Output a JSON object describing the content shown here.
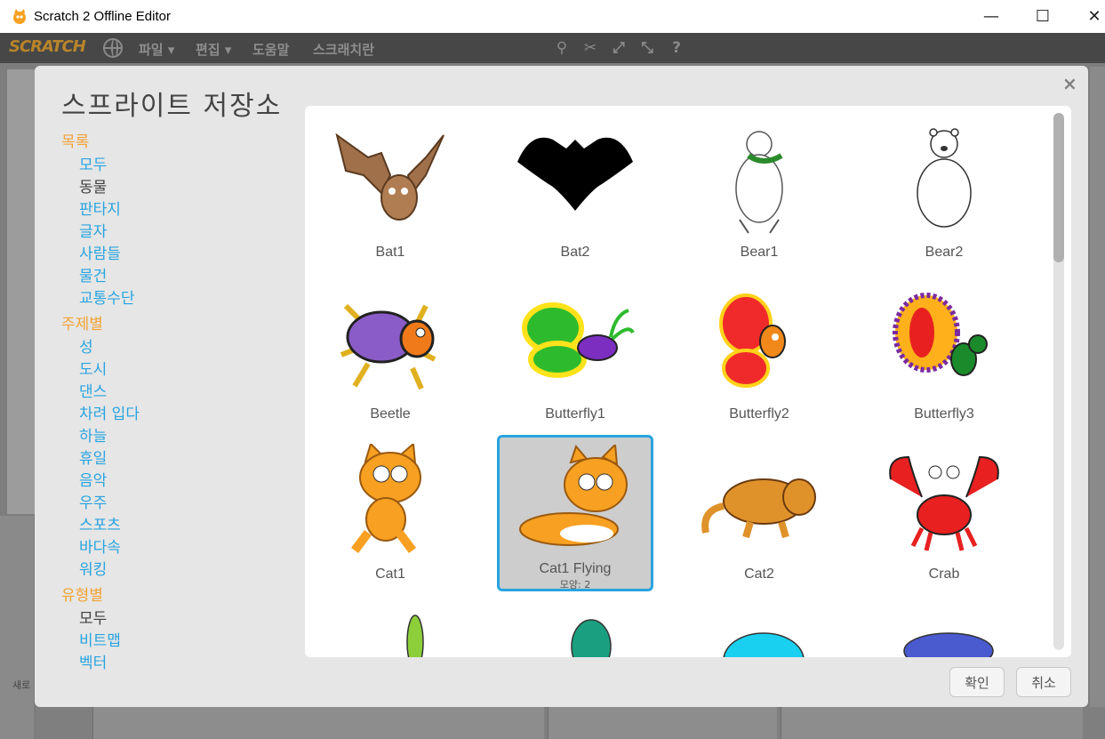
{
  "window": {
    "title": "Scratch 2 Offline Editor",
    "min": "—",
    "max": "☐",
    "close": "✕"
  },
  "menubar": {
    "logo": "SCRATCH",
    "items": [
      "파일 ▾",
      "편집 ▾",
      "도움말",
      "스크래치란"
    ],
    "tools": [
      "stamp-icon",
      "cut-icon",
      "grow-icon",
      "shrink-icon",
      "help-icon"
    ]
  },
  "background": {
    "new_label": "새로"
  },
  "dialog": {
    "title": "스프라이트 저장소",
    "close": "×",
    "sidebar": {
      "groups": [
        {
          "heading": "목록",
          "items": [
            "모두",
            "동물",
            "판타지",
            "글자",
            "사람들",
            "물건",
            "교통수단"
          ],
          "selected": "동물"
        },
        {
          "heading": "주제별",
          "items": [
            "성",
            "도시",
            "댄스",
            "차려 입다",
            "하늘",
            "휴일",
            "음악",
            "우주",
            "스포츠",
            "바다속",
            "워킹"
          ]
        },
        {
          "heading": "유형별",
          "items": [
            "모두",
            "비트맵",
            "벡터"
          ],
          "selected": "모두"
        }
      ]
    },
    "sprites": [
      {
        "name": "Bat1"
      },
      {
        "name": "Bat2"
      },
      {
        "name": "Bear1"
      },
      {
        "name": "Bear2"
      },
      {
        "name": "Beetle"
      },
      {
        "name": "Butterfly1"
      },
      {
        "name": "Butterfly2"
      },
      {
        "name": "Butterfly3"
      },
      {
        "name": "Cat1"
      },
      {
        "name": "Cat1 Flying",
        "costumes": "모양: 2",
        "selected": true
      },
      {
        "name": "Cat2"
      },
      {
        "name": "Crab"
      }
    ],
    "buttons": {
      "ok": "확인",
      "cancel": "취소"
    }
  }
}
